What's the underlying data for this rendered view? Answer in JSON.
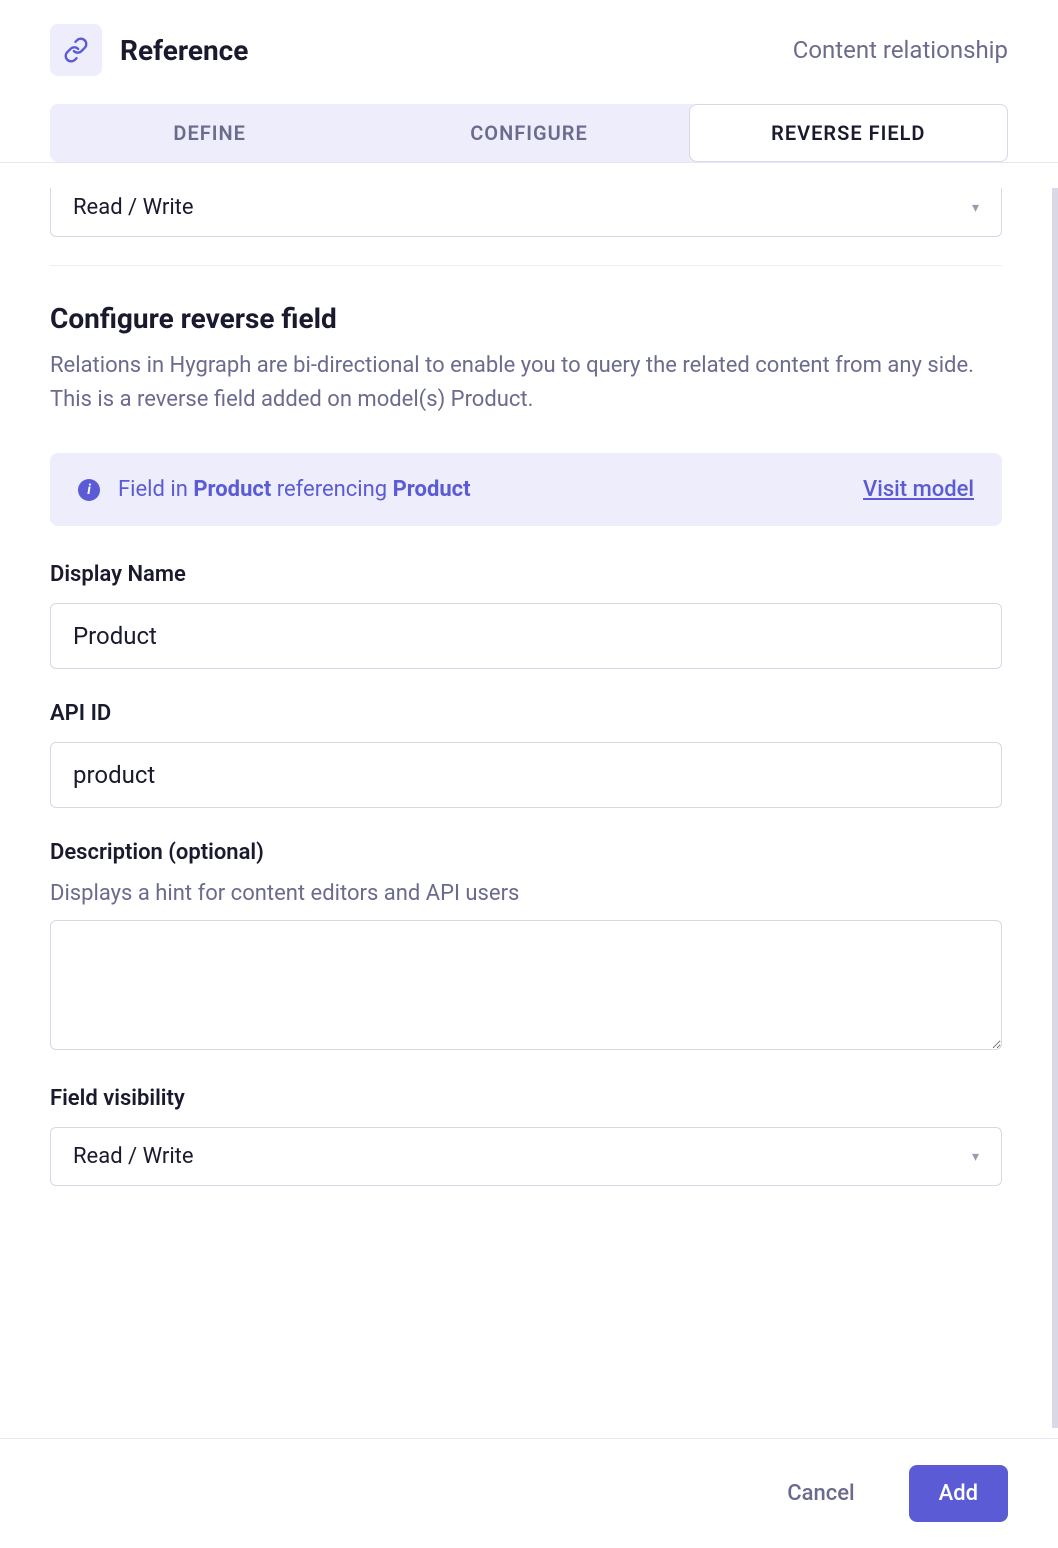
{
  "header": {
    "title": "Reference",
    "subtitle": "Content relationship"
  },
  "tabs": {
    "define": "Define",
    "configure": "Configure",
    "reverse": "Reverse field"
  },
  "peek_select": {
    "value": "Read / Write"
  },
  "section": {
    "title": "Configure reverse field",
    "description": "Relations in Hygraph are bi-directional to enable you to query the related content from any side. This is a reverse field added on model(s) Product."
  },
  "banner": {
    "prefix": "Field in ",
    "model1": "Product",
    "mid": " referencing ",
    "model2": "Product",
    "link": "Visit model"
  },
  "form": {
    "display_name": {
      "label": "Display Name",
      "value": "Product"
    },
    "api_id": {
      "label": "API ID",
      "value": "product"
    },
    "description": {
      "label": "Description (optional)",
      "hint": "Displays a hint for content editors and API users",
      "value": ""
    },
    "visibility": {
      "label": "Field visibility",
      "value": "Read / Write"
    }
  },
  "footer": {
    "cancel": "Cancel",
    "add": "Add"
  }
}
